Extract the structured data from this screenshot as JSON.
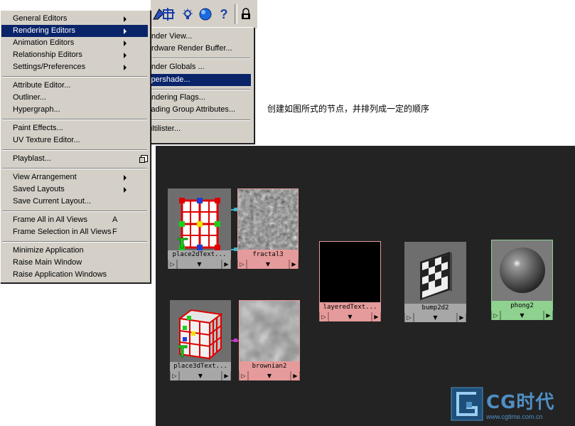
{
  "main_menu": {
    "items": [
      {
        "label": "General Editors",
        "submenu": true
      },
      {
        "label": "Rendering Editors",
        "submenu": true,
        "selected": true
      },
      {
        "label": "Animation Editors",
        "submenu": true
      },
      {
        "label": "Relationship Editors",
        "submenu": true
      },
      {
        "label": "Settings/Preferences",
        "submenu": true
      },
      {
        "label": "Attribute Editor..."
      },
      {
        "label": "Outliner..."
      },
      {
        "label": "Hypergraph..."
      },
      {
        "label": "Paint Effects..."
      },
      {
        "label": "UV Texture Editor..."
      },
      {
        "label": "Playblast...",
        "option_box": true
      },
      {
        "label": "View Arrangement",
        "submenu": true
      },
      {
        "label": "Saved Layouts",
        "submenu": true
      },
      {
        "label": "Save Current Layout..."
      },
      {
        "label": "Frame All in All Views",
        "shortcut": "A"
      },
      {
        "label": "Frame Selection in All Views",
        "shortcut": "F"
      },
      {
        "label": "Minimize Application"
      },
      {
        "label": "Raise Main Window"
      },
      {
        "label": "Raise Application Windows"
      }
    ]
  },
  "rendering_submenu": {
    "items": [
      {
        "label": "Render View..."
      },
      {
        "label": "Hardware Render Buffer..."
      },
      {
        "label": "Render Globals ..."
      },
      {
        "label": "Hypershade...",
        "selected": true
      },
      {
        "label": "Rendering Flags..."
      },
      {
        "label": "Shading Group Attributes..."
      },
      {
        "label": "Multilister..."
      }
    ]
  },
  "toolbar": {
    "icons": [
      "hypershade-icon",
      "uv-lattice-icon",
      "light-bulb-icon",
      "sphere-render-icon",
      "help-icon",
      "lock-icon"
    ],
    "help_label": "?"
  },
  "instruction_text": "创建如图所式的节点，并排列成一定的顺序",
  "hypershade": {
    "nodes": [
      {
        "name": "place2dTexture",
        "label": "place2dText...",
        "kind": "place2d",
        "label_color": "#a7a7a7"
      },
      {
        "name": "fractal3",
        "label": "fractal3",
        "kind": "fractal",
        "label_color": "#e59b9b"
      },
      {
        "name": "layeredTexture",
        "label": "layeredText...",
        "kind": "layered",
        "label_color": "#e59b9b"
      },
      {
        "name": "bump2d2",
        "label": "bump2d2",
        "kind": "bump",
        "label_color": "#a7a7a7"
      },
      {
        "name": "phong2",
        "label": "phong2",
        "kind": "phong",
        "label_color": "#8fd18f"
      },
      {
        "name": "place3dTexture",
        "label": "place3dText...",
        "kind": "place3d",
        "label_color": "#a7a7a7"
      },
      {
        "name": "brownian2",
        "label": "brownian2",
        "kind": "brownian",
        "label_color": "#e59b9b"
      }
    ],
    "control_glyphs": {
      "left": "▷",
      "middle": "▼",
      "right": "▶"
    }
  },
  "watermark": {
    "logo_text": "CG时代",
    "url": "www.cgtime.com.cn"
  },
  "colors": {
    "menu_bg": "#d4d0c8",
    "menu_selected": "#0a246a",
    "panel_bg": "#232323",
    "texture_label": "#e59b9b",
    "utility_label": "#a7a7a7",
    "shader_label": "#8fd18f",
    "connection_cyan": "#3bb7c9",
    "connection_magenta": "#c43cc4"
  }
}
